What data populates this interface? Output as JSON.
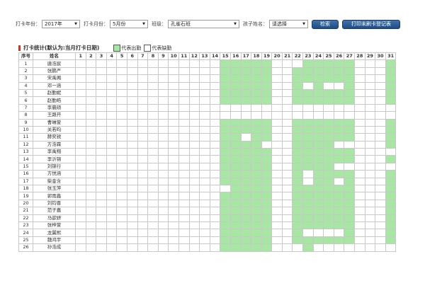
{
  "filters": {
    "year_label": "打卡年份：",
    "year_value": "2017年",
    "month_label": "打卡月份：",
    "month_value": "5月份",
    "class_label": "班级：",
    "class_value": "孔雀石班",
    "child_label": "孩子姓名：",
    "child_value": "请选择",
    "search_button": "检索",
    "print_button": "打印未刷卡登记表"
  },
  "stats": {
    "title": "打卡统计(默认为:当月打卡日期)",
    "legend_present": "代表出勤",
    "legend_absent": "代表缺勤"
  },
  "table": {
    "header_index": "序号",
    "header_name": "姓名",
    "days": [
      "1",
      "2",
      "3",
      "4",
      "5",
      "6",
      "7",
      "8",
      "9",
      "10",
      "11",
      "12",
      "13",
      "14",
      "15",
      "16",
      "17",
      "18",
      "19",
      "20",
      "21",
      "22",
      "23",
      "24",
      "25",
      "26",
      "27",
      "28",
      "29",
      "30",
      "31"
    ],
    "rows": [
      {
        "no": "1",
        "name": "唐浩宸",
        "present": [
          15,
          16,
          17,
          18,
          19,
          23,
          24,
          25,
          26,
          27,
          31
        ]
      },
      {
        "no": "2",
        "name": "张鹏严",
        "present": [
          15,
          16,
          17,
          18,
          19,
          22,
          23,
          24,
          25,
          26,
          27,
          31
        ]
      },
      {
        "no": "3",
        "name": "宋禹阁",
        "present": [
          15,
          16,
          17,
          18,
          19,
          22,
          23,
          24,
          25,
          26,
          27,
          31
        ]
      },
      {
        "no": "4",
        "name": "邓一涵",
        "present": [
          15,
          16,
          17,
          18,
          19,
          22,
          24,
          27,
          31
        ]
      },
      {
        "no": "5",
        "name": "赵勤妮",
        "present": [
          15,
          16,
          17,
          18,
          19,
          22,
          23,
          24,
          25,
          26,
          27,
          31
        ]
      },
      {
        "no": "6",
        "name": "赵勤皓",
        "present": [
          15,
          16,
          17,
          18,
          19,
          22,
          23,
          24,
          25,
          26,
          27,
          31
        ]
      },
      {
        "no": "7",
        "name": "李晨硕",
        "present": []
      },
      {
        "no": "8",
        "name": "王路开",
        "present": []
      },
      {
        "no": "9",
        "name": "曹琳萱",
        "present": [
          15,
          16,
          17,
          18,
          19,
          22,
          23,
          24,
          25,
          26,
          27,
          31
        ]
      },
      {
        "no": "10",
        "name": "关若昀",
        "present": [
          15,
          16,
          17,
          18,
          19,
          22,
          23,
          24,
          25,
          26,
          27,
          31
        ]
      },
      {
        "no": "11",
        "name": "赫奕锐",
        "present": [
          15,
          16,
          18,
          19,
          22,
          23,
          24,
          25,
          26,
          27,
          31
        ]
      },
      {
        "no": "12",
        "name": "方浩霖",
        "present": [
          15,
          16,
          17,
          18,
          22,
          23,
          24,
          25,
          31
        ]
      },
      {
        "no": "13",
        "name": "李禹翔",
        "present": [
          15,
          16,
          17,
          18,
          19,
          22,
          23,
          24,
          25,
          26,
          27
        ]
      },
      {
        "no": "14",
        "name": "李沂锦",
        "present": [
          15,
          16,
          17,
          18,
          19,
          22,
          23,
          24,
          25,
          26,
          27,
          31
        ]
      },
      {
        "no": "15",
        "name": "刘锦行",
        "present": [
          15,
          16,
          17,
          18,
          19,
          22,
          23,
          24,
          25
        ]
      },
      {
        "no": "16",
        "name": "方悦涵",
        "present": [
          15,
          16,
          17,
          18,
          19,
          22,
          24,
          25,
          26,
          27,
          31
        ]
      },
      {
        "no": "17",
        "name": "柴金含",
        "present": [
          15,
          16,
          17,
          18,
          19,
          22,
          24,
          25,
          27,
          31
        ]
      },
      {
        "no": "18",
        "name": "张玉萍",
        "present": [
          16,
          17,
          18,
          19,
          22,
          23,
          24,
          25,
          26,
          27,
          31
        ]
      },
      {
        "no": "19",
        "name": "郭雨鑫",
        "present": [
          15,
          16,
          17,
          18,
          19,
          22,
          23,
          24,
          25,
          26,
          27,
          31
        ]
      },
      {
        "no": "20",
        "name": "刘钧晋",
        "present": [
          15,
          16,
          17,
          18,
          19,
          22,
          23,
          24,
          25,
          26,
          27,
          31
        ]
      },
      {
        "no": "21",
        "name": "范子嘉",
        "present": [
          15,
          16,
          17,
          18,
          19,
          22,
          23,
          24,
          25,
          26,
          27,
          31
        ]
      },
      {
        "no": "22",
        "name": "马歆妍",
        "present": [
          15,
          16,
          17,
          18,
          19,
          22,
          23,
          24,
          25,
          26,
          27,
          31
        ]
      },
      {
        "no": "23",
        "name": "张梓萱",
        "present": [
          15,
          16,
          17,
          18,
          19,
          22,
          23,
          24,
          25,
          26,
          27,
          31
        ]
      },
      {
        "no": "24",
        "name": "龙翼熙",
        "present": [
          15,
          16,
          17,
          18,
          19,
          22,
          27,
          31
        ]
      },
      {
        "no": "25",
        "name": "魏鸿宇",
        "present": [
          15,
          16,
          17,
          18,
          19,
          22,
          23,
          24,
          25,
          26,
          27,
          31
        ]
      },
      {
        "no": "26",
        "name": "孙浩成",
        "present": [
          15,
          16,
          17,
          18,
          19,
          23
        ]
      }
    ]
  },
  "colors": {
    "present": "#a8e6a3",
    "button": "#1e4c83",
    "marker": "#c0392b"
  }
}
